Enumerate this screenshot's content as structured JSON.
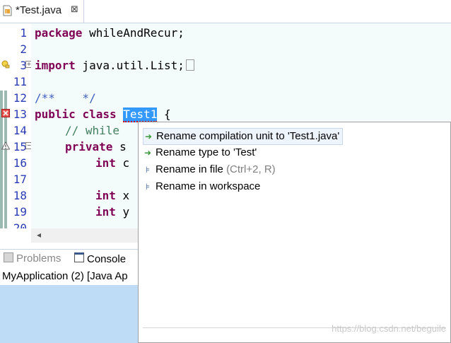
{
  "editor": {
    "tab_label": "*Test.java",
    "close_glyph": "⊠",
    "line_numbers": [
      "1",
      "2",
      "3",
      "11",
      "12",
      "13",
      "14",
      "15",
      "16",
      "17",
      "18",
      "19",
      "20"
    ],
    "lines": {
      "l1_kw": "package",
      "l1_rest": " whileAndRecur;",
      "l3_kw": "import",
      "l3_rest": " java.util.List;",
      "l12_doc": "/**    */",
      "l13_kw1": "public",
      "l13_kw2": "class",
      "l13_sel": "Test1",
      "l13_rest": " {",
      "l14_comment": "// while",
      "l15_kw": "private",
      "l15_rest": " s",
      "l16_kw": "int",
      "l16_rest": " c",
      "l18_kw": "int",
      "l18_rest": " x",
      "l19_kw": "int",
      "l19_rest": " y"
    }
  },
  "views": {
    "problems_label": "Problems",
    "console_label": "Console",
    "console_title": "MyApplication (2) [Java Ap"
  },
  "quick_fix": {
    "proposals": [
      {
        "label": "Rename compilation unit to 'Test1.java'",
        "icon": "change-icon",
        "selected": true
      },
      {
        "label": "Rename type to 'Test'",
        "icon": "change-icon"
      },
      {
        "label": "Rename in file",
        "shortcut": "(Ctrl+2, R)",
        "icon": "linked-rename-icon"
      },
      {
        "label": "Rename in workspace",
        "icon": "linked-rename-icon"
      }
    ],
    "watermark": "https://blog.csdn.net/beguile"
  },
  "colors": {
    "keyword": "#7f0055",
    "comment": "#3f7f5f",
    "javadoc": "#3f5fbf",
    "line_number": "#2a3cb4",
    "selection": "#3399ff"
  }
}
